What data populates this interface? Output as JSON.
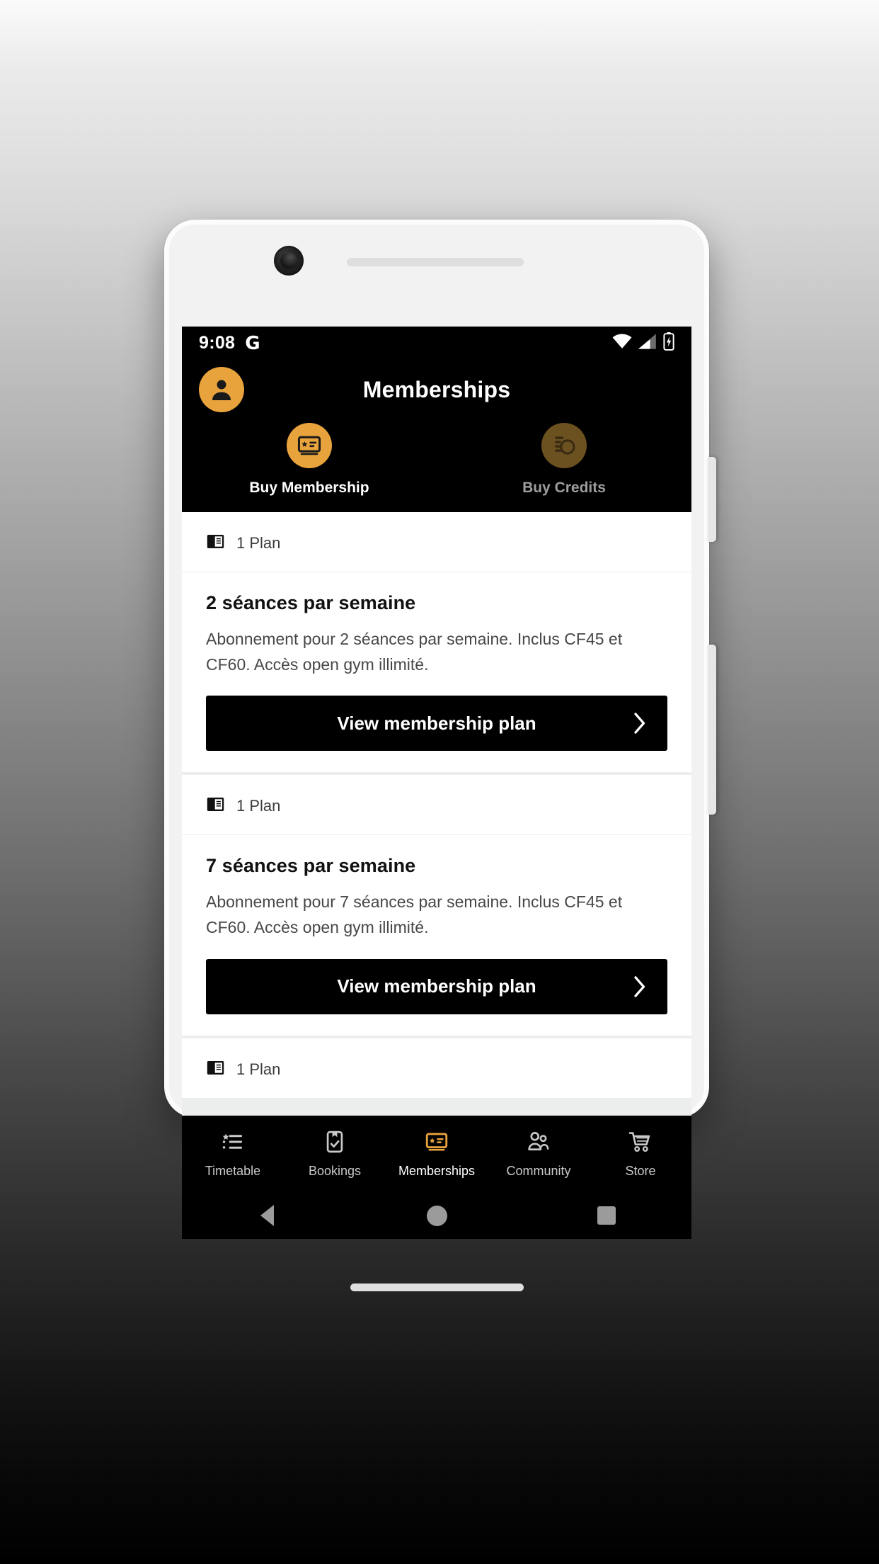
{
  "status_bar": {
    "time": "9:08",
    "google_glyph": "G",
    "icons": [
      "wifi-icon",
      "cellular-signal-icon",
      "battery-charging-icon"
    ]
  },
  "header": {
    "title": "Memberships",
    "avatar_icon": "user-avatar-icon",
    "quick_actions": [
      {
        "label": "Buy Membership",
        "icon": "membership-card-icon",
        "state": "active"
      },
      {
        "label": "Buy Credits",
        "icon": "credits-coin-icon",
        "state": "dim"
      }
    ]
  },
  "content": {
    "cards": [
      {
        "plan_count": "1 Plan",
        "plan_icon": "plan-card-icon",
        "title": "2 séances par semaine",
        "description": "Abonnement pour 2 séances par semaine. Inclus CF45 et CF60. Accès open gym illimité.",
        "button_label": "View membership plan",
        "button_chevron": "chevron-right-icon"
      },
      {
        "plan_count": "1 Plan",
        "plan_icon": "plan-card-icon",
        "title": "7 séances par semaine",
        "description": "Abonnement pour 7 séances par semaine. Inclus CF45 et CF60. Accès open gym illimité.",
        "button_label": "View membership plan",
        "button_chevron": "chevron-right-icon"
      },
      {
        "plan_count": "1 Plan",
        "plan_icon": "plan-card-icon"
      }
    ]
  },
  "bottom_nav": {
    "items": [
      {
        "label": "Timetable",
        "icon": "timetable-list-icon",
        "state": "inactive"
      },
      {
        "label": "Bookings",
        "icon": "bookings-clipboard-icon",
        "state": "inactive"
      },
      {
        "label": "Memberships",
        "icon": "membership-card-icon",
        "state": "active"
      },
      {
        "label": "Community",
        "icon": "community-people-icon",
        "state": "inactive"
      },
      {
        "label": "Store",
        "icon": "store-cart-icon",
        "state": "inactive"
      }
    ]
  },
  "system_nav": {
    "back": "back-triangle-icon",
    "home": "home-circle-icon",
    "recents": "recents-square-icon"
  },
  "colors": {
    "accent": "#E8A33D",
    "accent_dim": "#6B5020",
    "surface": "#FFFFFF",
    "chrome": "#000000"
  }
}
